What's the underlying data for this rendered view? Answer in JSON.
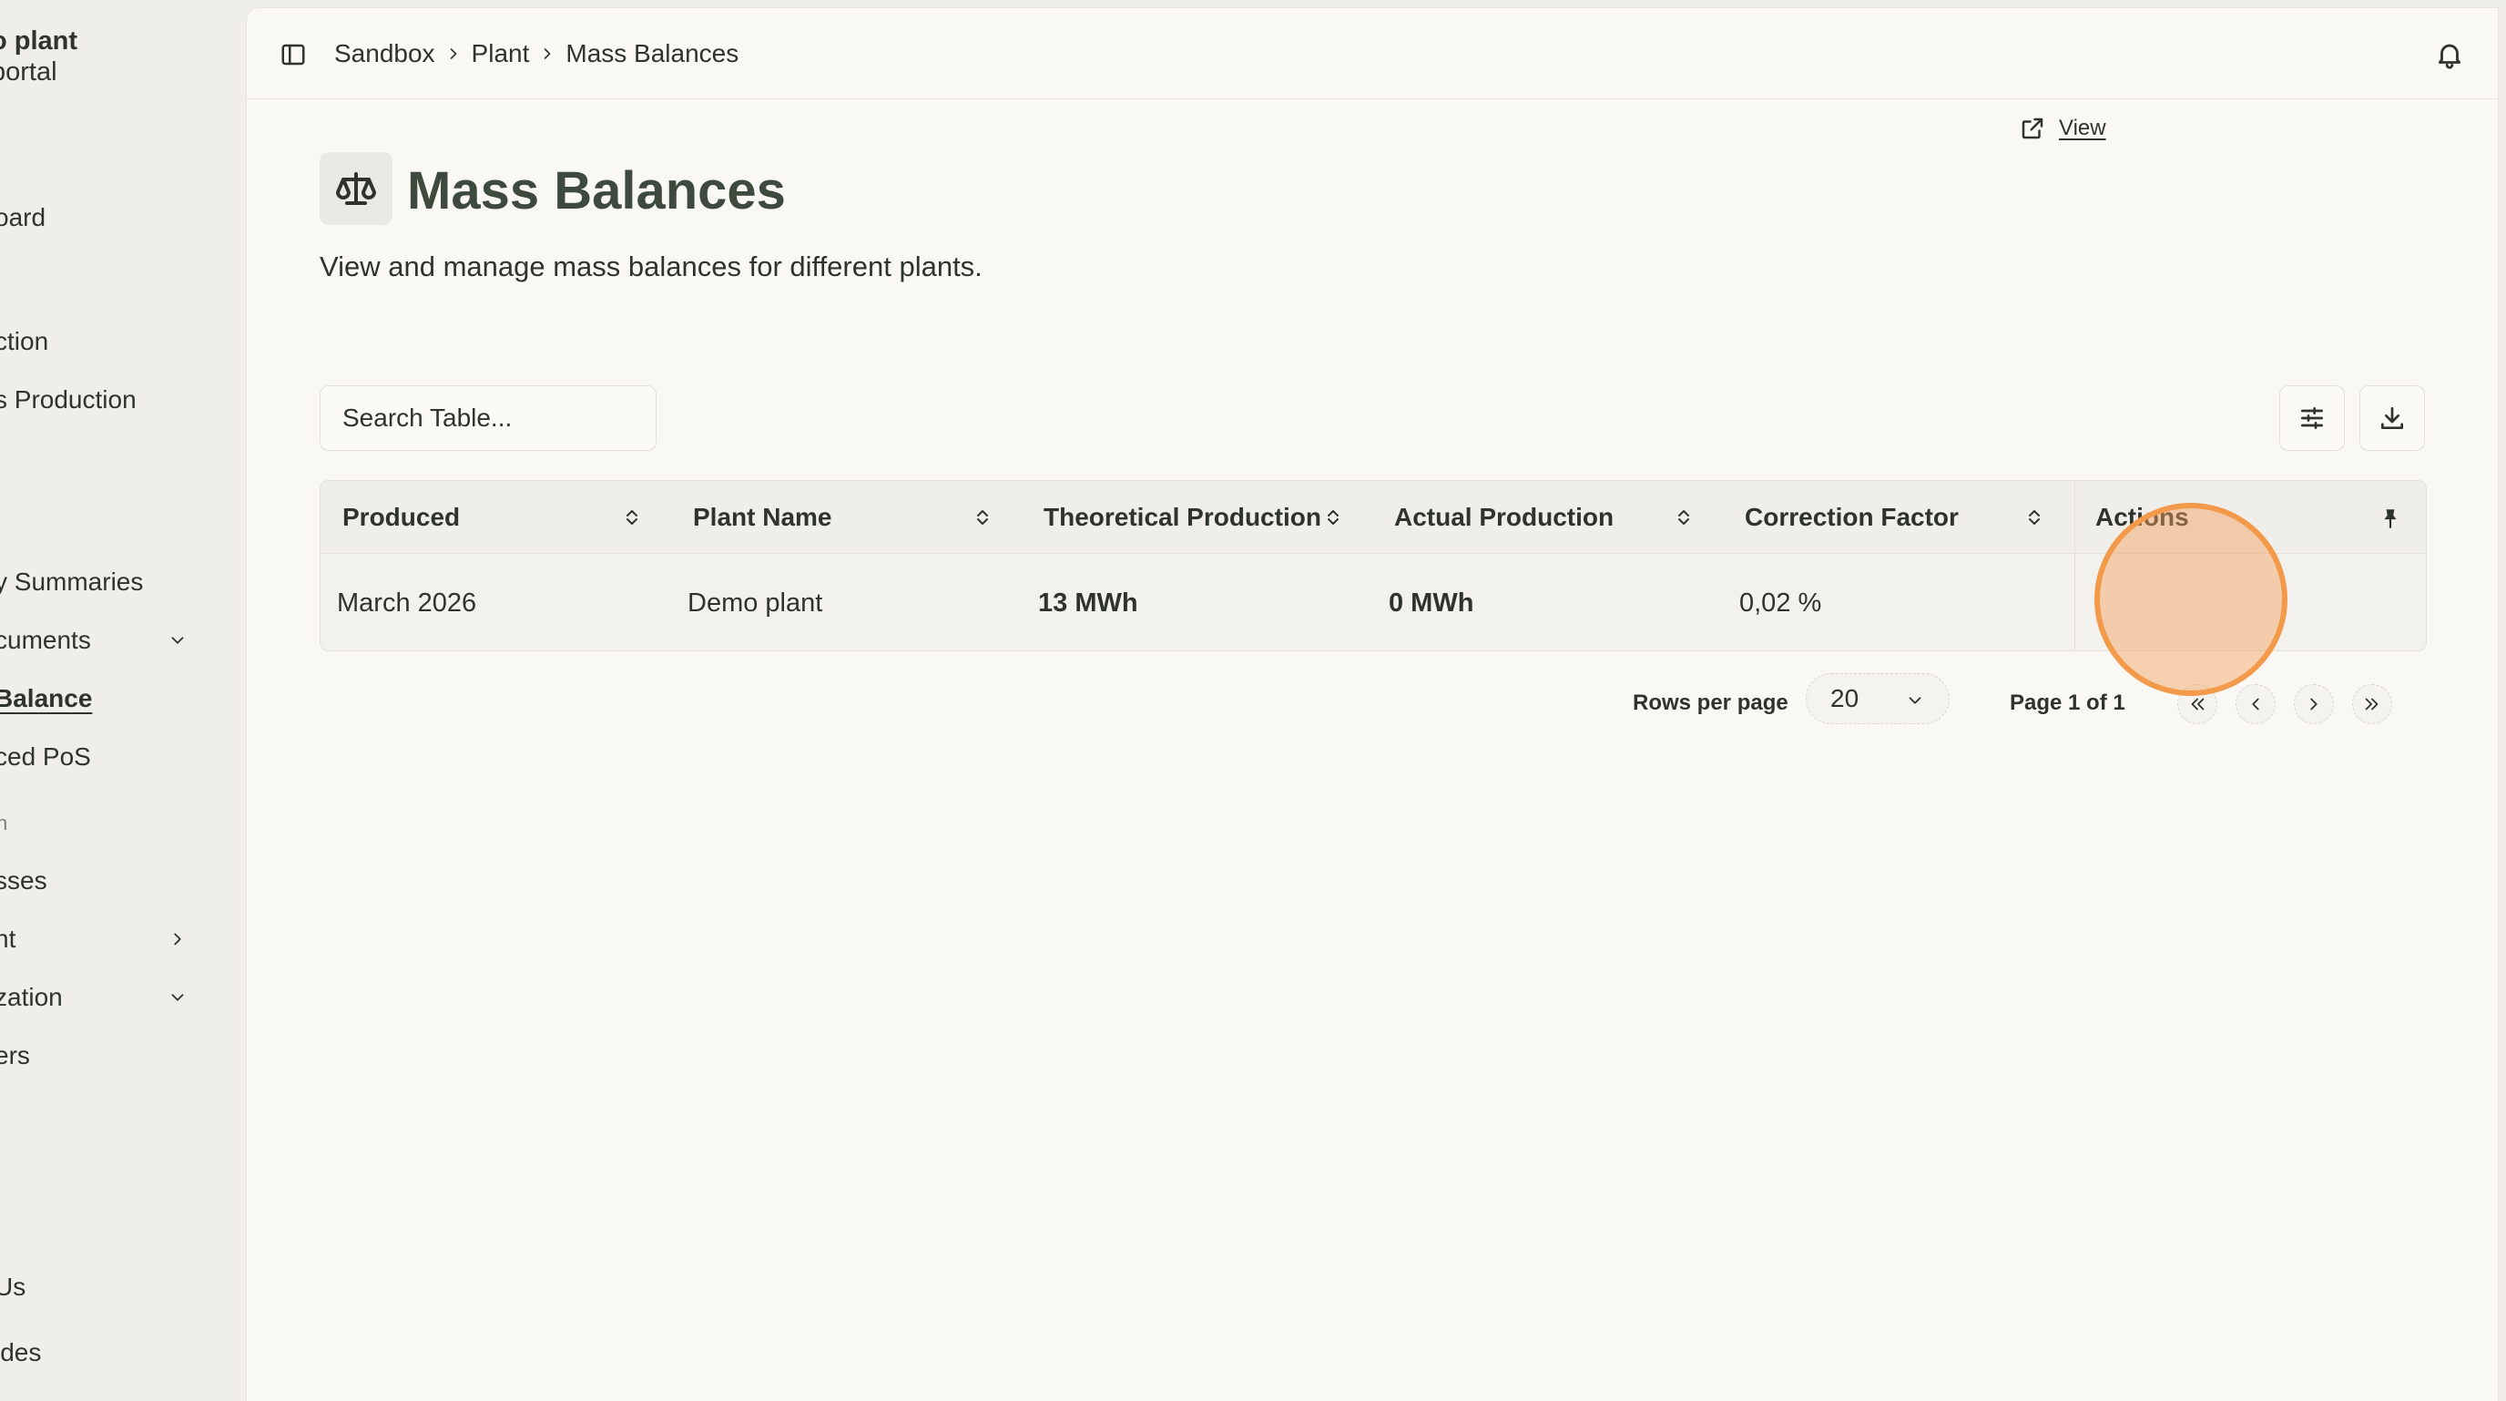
{
  "sidebar": {
    "brand_line1": "o plant",
    "brand_line2": "portal",
    "items": [
      {
        "label": "oard"
      },
      {
        "label": "ction"
      },
      {
        "label": "s Production"
      },
      {
        "label": "y Summaries"
      },
      {
        "label": "cuments"
      },
      {
        "label": "Balance"
      },
      {
        "label": "ced PoS"
      },
      {
        "label": "sses"
      },
      {
        "label": "nt"
      },
      {
        "label": "zation"
      },
      {
        "label": "ers"
      },
      {
        "label": "Us"
      },
      {
        "label": "ides"
      }
    ],
    "section_label": "n"
  },
  "topbar": {
    "breadcrumbs": [
      "Sandbox",
      "Plant",
      "Mass Balances"
    ]
  },
  "page": {
    "title": "Mass Balances",
    "subtitle": "View and manage mass balances for different plants."
  },
  "search": {
    "placeholder": "Search Table..."
  },
  "table": {
    "columns": [
      "Produced",
      "Plant Name",
      "Theoretical Production",
      "Actual Production",
      "Correction Factor",
      "Actions"
    ],
    "rows": [
      {
        "produced": "March 2026",
        "plant_name": "Demo plant",
        "theoretical": "13 MWh",
        "actual": "0 MWh",
        "correction": "0,02 %",
        "action": "View"
      }
    ]
  },
  "pagination": {
    "rows_per_page_label": "Rows per page",
    "rows_per_page_value": "20",
    "page_info": "Page 1 of 1"
  },
  "colors": {
    "background": "#efeeea",
    "panel": "#faf8f4",
    "title": "#3e4a3e",
    "highlight": "#f39a4a"
  }
}
